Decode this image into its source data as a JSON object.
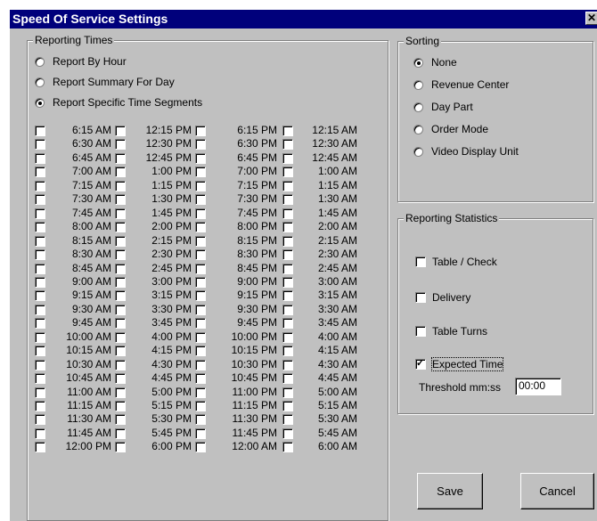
{
  "window": {
    "title": "Speed Of Service Settings",
    "close_glyph": "✕"
  },
  "reporting_times": {
    "legend": "Reporting Times",
    "options": [
      {
        "label": "Report By Hour",
        "selected": false
      },
      {
        "label": "Report Summary For Day",
        "selected": false
      },
      {
        "label": "Report Specific Time Segments",
        "selected": true
      }
    ],
    "columns": [
      [
        "6:15 AM",
        "6:30 AM",
        "6:45 AM",
        "7:00 AM",
        "7:15 AM",
        "7:30 AM",
        "7:45 AM",
        "8:00 AM",
        "8:15 AM",
        "8:30 AM",
        "8:45 AM",
        "9:00 AM",
        "9:15 AM",
        "9:30 AM",
        "9:45 AM",
        "10:00 AM",
        "10:15 AM",
        "10:30 AM",
        "10:45 AM",
        "11:00 AM",
        "11:15 AM",
        "11:30 AM",
        "11:45 AM",
        "12:00 PM"
      ],
      [
        "12:15 PM",
        "12:30 PM",
        "12:45 PM",
        "1:00 PM",
        "1:15 PM",
        "1:30 PM",
        "1:45 PM",
        "2:00 PM",
        "2:15 PM",
        "2:30 PM",
        "2:45 PM",
        "3:00 PM",
        "3:15 PM",
        "3:30 PM",
        "3:45 PM",
        "4:00 PM",
        "4:15 PM",
        "4:30 PM",
        "4:45 PM",
        "5:00 PM",
        "5:15 PM",
        "5:30 PM",
        "5:45 PM",
        "6:00 PM"
      ],
      [
        "6:15 PM",
        "6:30 PM",
        "6:45 PM",
        "7:00 PM",
        "7:15 PM",
        "7:30 PM",
        "7:45 PM",
        "8:00 PM",
        "8:15 PM",
        "8:30 PM",
        "8:45 PM",
        "9:00 PM",
        "9:15 PM",
        "9:30 PM",
        "9:45 PM",
        "10:00 PM",
        "10:15 PM",
        "10:30 PM",
        "10:45 PM",
        "11:00 PM",
        "11:15 PM",
        "11:30 PM",
        "11:45 PM",
        "12:00 AM"
      ],
      [
        "12:15 AM",
        "12:30 AM",
        "12:45 AM",
        "1:00 AM",
        "1:15 AM",
        "1:30 AM",
        "1:45 AM",
        "2:00 AM",
        "2:15 AM",
        "2:30 AM",
        "2:45 AM",
        "3:00 AM",
        "3:15 AM",
        "3:30 AM",
        "3:45 AM",
        "4:00 AM",
        "4:15 AM",
        "4:30 AM",
        "4:45 AM",
        "5:00 AM",
        "5:15 AM",
        "5:30 AM",
        "5:45 AM",
        "6:00 AM"
      ]
    ]
  },
  "sorting": {
    "legend": "Sorting",
    "options": [
      {
        "label": "None",
        "selected": true
      },
      {
        "label": "Revenue Center",
        "selected": false
      },
      {
        "label": "Day Part",
        "selected": false
      },
      {
        "label": "Order Mode",
        "selected": false
      },
      {
        "label": "Video Display Unit",
        "selected": false
      }
    ]
  },
  "reporting_statistics": {
    "legend": "Reporting Statistics",
    "items": [
      {
        "label": "Table / Check",
        "checked": false
      },
      {
        "label": "Delivery",
        "checked": false
      },
      {
        "label": "Table Turns",
        "checked": false
      },
      {
        "label": "Expected Time",
        "checked": true
      }
    ],
    "threshold_label": "Threshold mm:ss",
    "threshold_value": "00:00"
  },
  "buttons": {
    "save": "Save",
    "cancel": "Cancel"
  }
}
